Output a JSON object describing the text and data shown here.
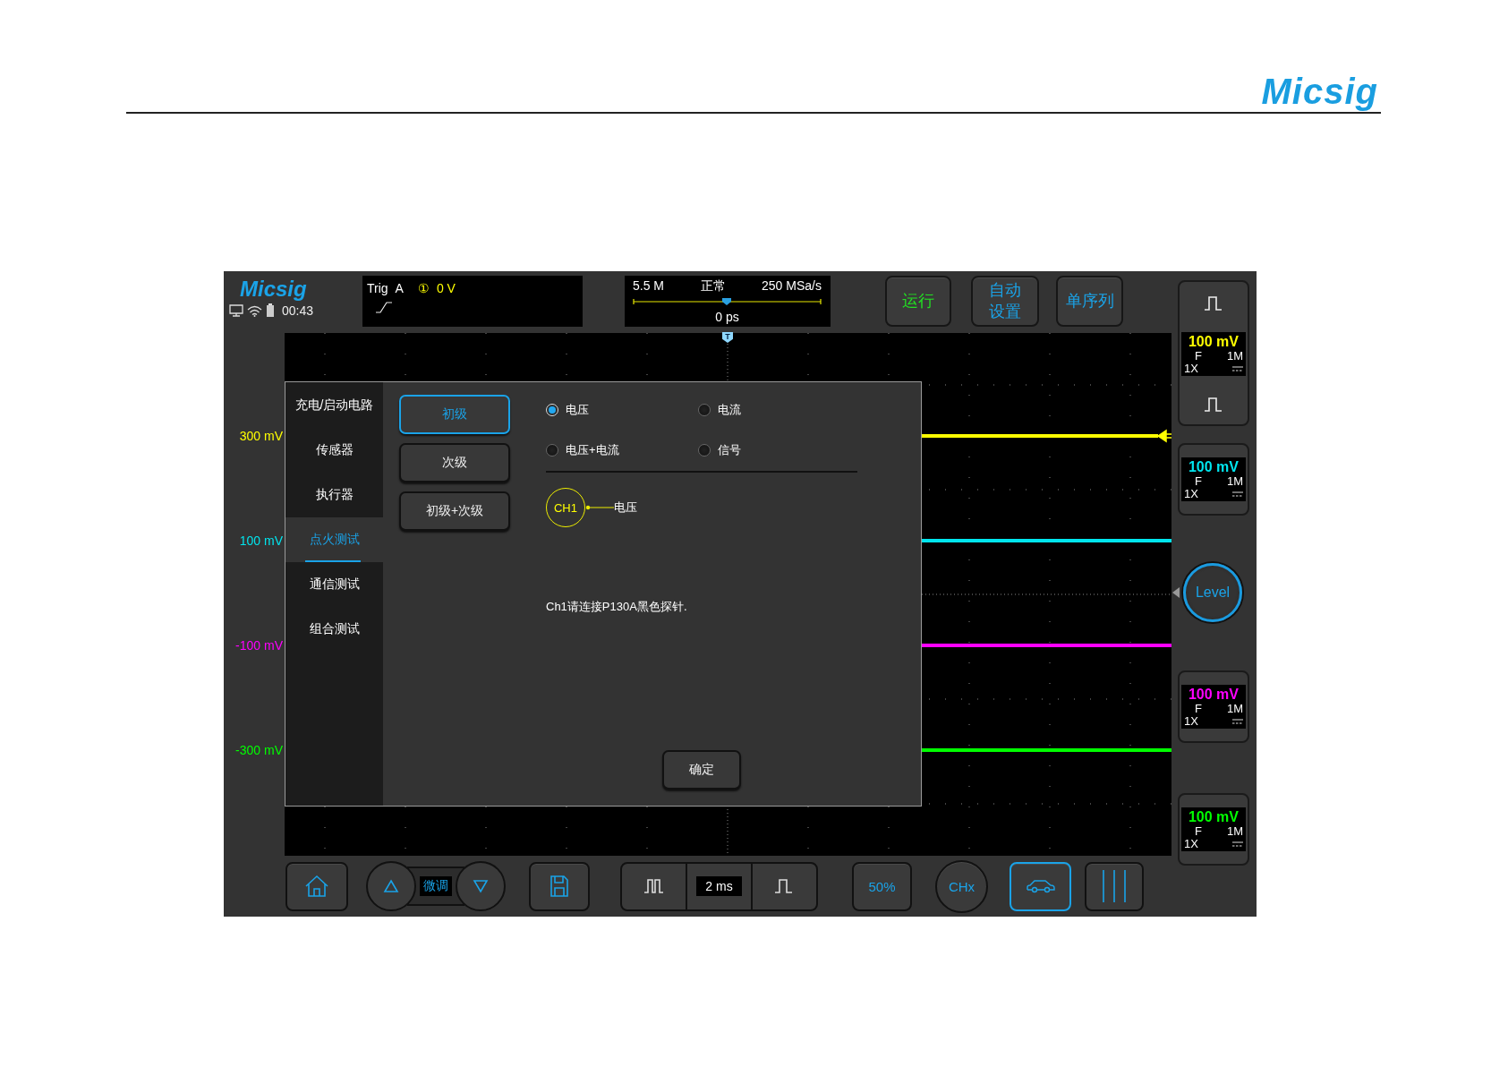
{
  "header": {
    "logo": "Micsig"
  },
  "scope": {
    "logo": "Micsig",
    "time": "00:43",
    "trigger": {
      "label": "Trig",
      "source": "A",
      "channel": "①",
      "level": "0 V"
    },
    "acquisition": {
      "memory": "5.5 M",
      "mode": "正常",
      "sample_rate": "250 MSa/s",
      "position": "0 ps"
    },
    "top_buttons": [
      {
        "label": "运行",
        "color": "#22e022"
      },
      {
        "label": "自动设置",
        "color": "#1aa3e8"
      },
      {
        "label": "单序列",
        "color": "#1aa3e8"
      }
    ],
    "trigger_marker": "T",
    "scale_labels": [
      {
        "text": "300 mV",
        "color": "#ffff00"
      },
      {
        "text": "100 mV",
        "color": "#00e5ee"
      },
      {
        "text": "-100 mV",
        "color": "#ff00ff"
      },
      {
        "text": "-300 mV",
        "color": "#00ff00"
      }
    ],
    "channels": [
      {
        "scale": "100 mV",
        "coupling": "F",
        "impedance": "1M",
        "probe": "1X",
        "color": "#ffff00"
      },
      {
        "scale": "100 mV",
        "coupling": "F",
        "impedance": "1M",
        "probe": "1X",
        "color": "#00e5ee"
      },
      {
        "scale": "100 mV",
        "coupling": "F",
        "impedance": "1M",
        "probe": "1X",
        "color": "#ff00ff"
      },
      {
        "scale": "100 mV",
        "coupling": "F",
        "impedance": "1M",
        "probe": "1X",
        "color": "#00ff00"
      }
    ],
    "level_knob": "Level",
    "dialog": {
      "categories": [
        {
          "label": "充电/启动电路",
          "selected": false
        },
        {
          "label": "传感器",
          "selected": false
        },
        {
          "label": "执行器",
          "selected": false
        },
        {
          "label": "点火测试",
          "selected": true
        },
        {
          "label": "通信测试",
          "selected": false
        },
        {
          "label": "组合测试",
          "selected": false
        }
      ],
      "modes": [
        {
          "label": "初级",
          "selected": true
        },
        {
          "label": "次级",
          "selected": false
        },
        {
          "label": "初级+次级",
          "selected": false
        }
      ],
      "options": [
        {
          "label": "电压",
          "selected": true
        },
        {
          "label": "电流",
          "selected": false
        },
        {
          "label": "电压+电流",
          "selected": false
        },
        {
          "label": "信号",
          "selected": false
        }
      ],
      "diagram": {
        "channel": "CH1",
        "signal": "电压"
      },
      "instruction": "Ch1请连接P130A黑色探针.",
      "confirm": "确定"
    },
    "toolbar": [
      {
        "kind": "home",
        "selected": false
      },
      {
        "kind": "fine_tune",
        "label": "微调"
      },
      {
        "kind": "save",
        "selected": false
      },
      {
        "kind": "timebase",
        "value": "2 ms"
      },
      {
        "kind": "percent",
        "label": "50%",
        "selected": false
      },
      {
        "kind": "channel",
        "label": "CHx",
        "selected": false
      },
      {
        "kind": "vehicle",
        "selected": true
      },
      {
        "kind": "cursor",
        "selected": false
      }
    ]
  }
}
